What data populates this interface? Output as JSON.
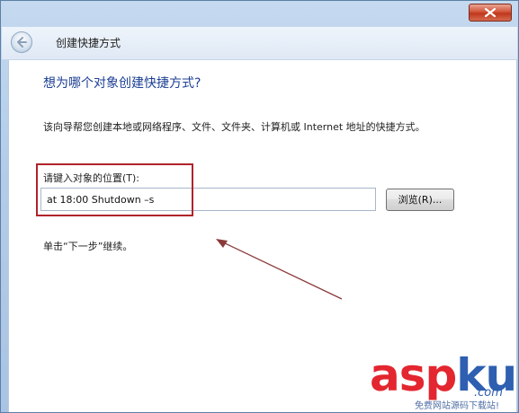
{
  "window": {
    "title": "创建快捷方式"
  },
  "main": {
    "heading": "想为哪个对象创建快捷方式?",
    "description": "该向导帮您创建本地或网络程序、文件、文件夹、计算机或 Internet 地址的快捷方式。",
    "location_label": "请键入对象的位置(T):",
    "location_value": "at 18:00 Shutdown –s",
    "browse_label": "浏览(R)...",
    "continue_text": "单击“下一步”继续。"
  },
  "watermark": {
    "main": "asp",
    "ku": "ku",
    "com": ".com",
    "sub": "免费网站源码下载站!"
  },
  "colors": {
    "heading": "#1c3f94",
    "highlight": "#b0232a",
    "close_button": "#c0371d"
  },
  "icons": [
    "close-icon",
    "back-arrow-icon",
    "annotation-arrow"
  ]
}
